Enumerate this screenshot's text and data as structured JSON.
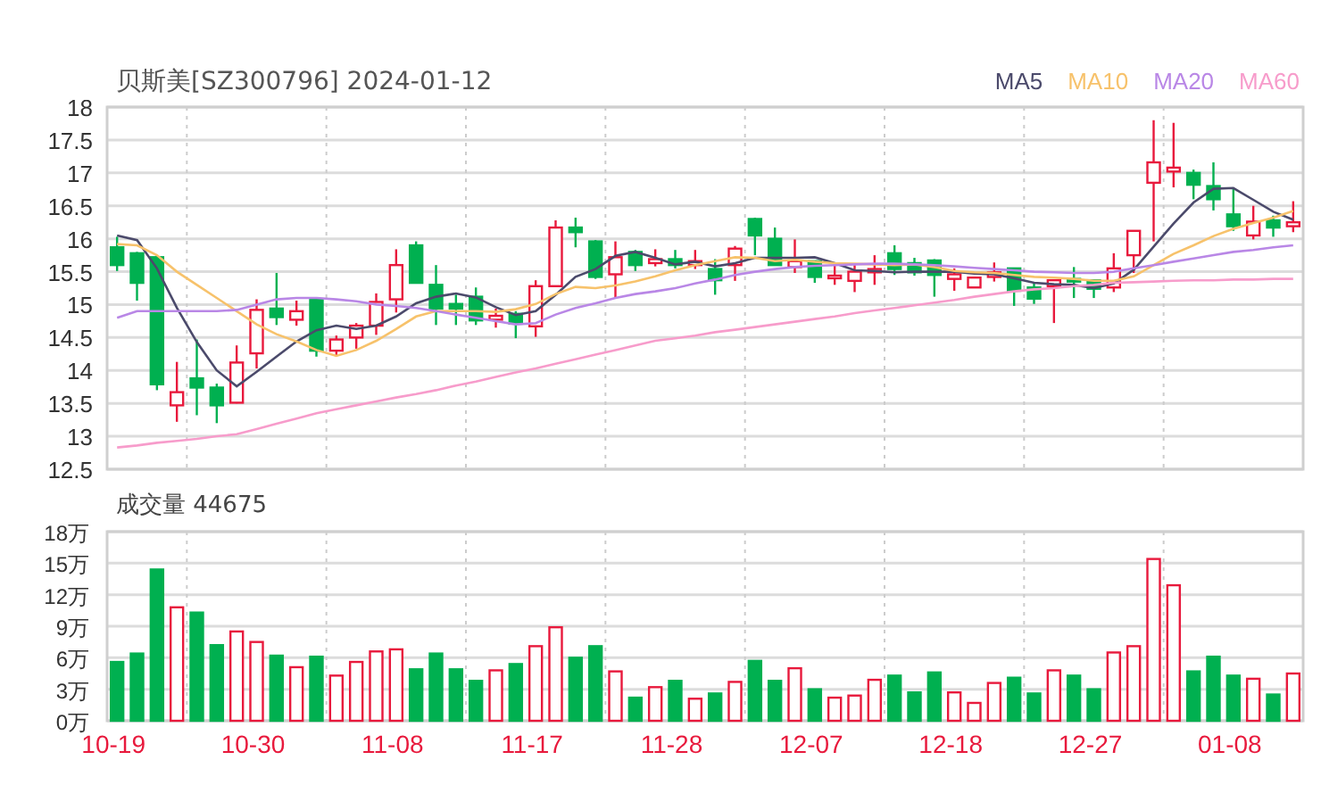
{
  "header": {
    "title": "贝斯美[SZ300796] 2024-01-12"
  },
  "price_chart": {
    "chart_data": {
      "type": "candlestick",
      "grid": true,
      "categories": [
        null,
        null,
        null,
        null,
        null,
        null,
        null,
        null,
        null,
        null,
        null,
        null,
        null,
        null,
        null,
        null,
        null,
        null,
        null,
        null,
        null,
        null,
        null,
        null,
        null,
        null,
        null,
        null,
        null,
        null,
        null,
        null,
        null,
        null,
        null,
        null,
        null,
        null,
        null,
        null,
        null,
        null,
        null,
        null,
        null,
        null,
        null,
        null,
        null,
        null,
        null,
        null,
        null,
        null,
        null,
        null,
        null,
        null,
        null,
        null
      ],
      "ylim": [
        12.5,
        18
      ],
      "yticks": [
        12.5,
        13,
        13.5,
        14,
        14.5,
        15,
        15.5,
        16,
        16.5,
        17,
        17.5,
        18
      ],
      "ohlc": [
        [
          15.87,
          16.03,
          15.51,
          15.6
        ],
        [
          15.78,
          15.8,
          15.06,
          15.33
        ],
        [
          15.72,
          15.75,
          13.7,
          13.79
        ],
        [
          13.47,
          14.13,
          13.22,
          13.67
        ],
        [
          13.88,
          14.47,
          13.32,
          13.74
        ],
        [
          13.74,
          13.8,
          13.2,
          13.47
        ],
        [
          13.51,
          14.38,
          13.5,
          14.12
        ],
        [
          14.26,
          15.08,
          14.03,
          14.92
        ],
        [
          14.94,
          15.48,
          14.69,
          14.81
        ],
        [
          14.77,
          15.06,
          14.68,
          14.9
        ],
        [
          15.08,
          15.1,
          14.21,
          14.3
        ],
        [
          14.3,
          14.53,
          14.21,
          14.47
        ],
        [
          14.5,
          14.72,
          14.33,
          14.68
        ],
        [
          14.68,
          15.17,
          14.54,
          15.04
        ],
        [
          15.08,
          15.84,
          14.88,
          15.6
        ],
        [
          15.9,
          15.96,
          15.33,
          15.33
        ],
        [
          15.3,
          15.6,
          14.69,
          14.94
        ],
        [
          15.01,
          15.15,
          14.69,
          14.94
        ],
        [
          15.12,
          15.26,
          14.69,
          14.76
        ],
        [
          14.77,
          14.94,
          14.65,
          14.83
        ],
        [
          14.86,
          14.9,
          14.49,
          14.71
        ],
        [
          14.67,
          15.37,
          14.51,
          15.28
        ],
        [
          15.28,
          16.28,
          15.28,
          16.17
        ],
        [
          16.17,
          16.32,
          15.87,
          16.1
        ],
        [
          15.96,
          15.98,
          15.39,
          15.42
        ],
        [
          15.46,
          15.96,
          15.1,
          15.72
        ],
        [
          15.8,
          15.83,
          15.51,
          15.6
        ],
        [
          15.63,
          15.84,
          15.58,
          15.69
        ],
        [
          15.69,
          15.83,
          15.55,
          15.6
        ],
        [
          15.6,
          15.83,
          15.54,
          15.66
        ],
        [
          15.54,
          15.69,
          15.15,
          15.37
        ],
        [
          15.6,
          15.89,
          15.36,
          15.85
        ],
        [
          16.3,
          16.32,
          15.75,
          16.05
        ],
        [
          16.0,
          16.17,
          15.6,
          15.6
        ],
        [
          15.57,
          15.99,
          15.48,
          15.66
        ],
        [
          15.66,
          15.66,
          15.33,
          15.42
        ],
        [
          15.4,
          15.6,
          15.3,
          15.44
        ],
        [
          15.36,
          15.6,
          15.19,
          15.5
        ],
        [
          15.49,
          15.75,
          15.3,
          15.54
        ],
        [
          15.78,
          15.9,
          15.45,
          15.54
        ],
        [
          15.63,
          15.71,
          15.44,
          15.49
        ],
        [
          15.67,
          15.69,
          15.12,
          15.45
        ],
        [
          15.39,
          15.55,
          15.21,
          15.46
        ],
        [
          15.26,
          15.41,
          15.26,
          15.41
        ],
        [
          15.42,
          15.64,
          15.35,
          15.49
        ],
        [
          15.55,
          15.55,
          14.98,
          15.21
        ],
        [
          15.26,
          15.33,
          15.01,
          15.09
        ],
        [
          15.28,
          15.37,
          14.72,
          15.37
        ],
        [
          15.39,
          15.57,
          15.1,
          15.35
        ],
        [
          15.37,
          15.37,
          15.1,
          15.24
        ],
        [
          15.26,
          15.78,
          15.19,
          15.55
        ],
        [
          15.75,
          16.12,
          15.48,
          16.12
        ],
        [
          16.85,
          17.8,
          15.96,
          17.16
        ],
        [
          17.02,
          17.76,
          16.78,
          17.08
        ],
        [
          17.0,
          17.05,
          16.6,
          16.82
        ],
        [
          16.8,
          17.16,
          16.43,
          16.6
        ],
        [
          16.37,
          16.78,
          16.12,
          16.19
        ],
        [
          16.05,
          16.5,
          15.99,
          16.26
        ],
        [
          16.28,
          16.35,
          16.03,
          16.17
        ],
        [
          16.19,
          16.57,
          16.1,
          16.25
        ]
      ]
    }
  },
  "moving_averages": {
    "chart_data": {
      "type": "line",
      "categories": [
        null,
        null,
        null,
        null,
        null,
        null,
        null,
        null,
        null,
        null,
        null,
        null,
        null,
        null,
        null,
        null,
        null,
        null,
        null,
        null,
        null,
        null,
        null,
        null,
        null,
        null,
        null,
        null,
        null,
        null,
        null,
        null,
        null,
        null,
        null,
        null,
        null,
        null,
        null,
        null,
        null,
        null,
        null,
        null,
        null,
        null,
        null,
        null,
        null,
        null,
        null,
        null,
        null,
        null,
        null,
        null,
        null,
        null,
        null,
        null
      ],
      "ylim": [
        12.5,
        18
      ],
      "series": [
        {
          "name": "MA5",
          "color": "#4b4a6b",
          "values": [
            16.05,
            15.98,
            15.55,
            14.95,
            14.43,
            14.0,
            13.76,
            13.98,
            14.21,
            14.44,
            14.61,
            14.68,
            14.63,
            14.68,
            14.82,
            15.02,
            15.12,
            15.17,
            15.11,
            14.96,
            14.84,
            14.9,
            15.15,
            15.42,
            15.54,
            15.74,
            15.8,
            15.71,
            15.61,
            15.65,
            15.58,
            15.63,
            15.71,
            15.71,
            15.71,
            15.72,
            15.63,
            15.52,
            15.51,
            15.49,
            15.5,
            15.5,
            15.5,
            15.47,
            15.46,
            15.4,
            15.33,
            15.31,
            15.3,
            15.25,
            15.32,
            15.53,
            15.88,
            16.23,
            16.55,
            16.76,
            16.77,
            16.59,
            16.41,
            16.29
          ]
        },
        {
          "name": "MA10",
          "color": "#f7c26b",
          "values": [
            15.92,
            15.9,
            15.75,
            15.5,
            15.3,
            15.1,
            14.9,
            14.7,
            14.55,
            14.44,
            14.31,
            14.22,
            14.31,
            14.45,
            14.63,
            14.82,
            14.9,
            14.9,
            14.9,
            14.89,
            14.93,
            15.01,
            15.16,
            15.27,
            15.25,
            15.29,
            15.35,
            15.43,
            15.52,
            15.6,
            15.66,
            15.72,
            15.71,
            15.66,
            15.68,
            15.65,
            15.63,
            15.62,
            15.61,
            15.6,
            15.61,
            15.57,
            15.51,
            15.49,
            15.48,
            15.45,
            15.42,
            15.41,
            15.39,
            15.36,
            15.36,
            15.43,
            15.6,
            15.77,
            15.9,
            16.04,
            16.15,
            16.24,
            16.32,
            16.42
          ]
        },
        {
          "name": "MA20",
          "color": "#b987e6",
          "values": [
            14.8,
            14.9,
            14.9,
            14.9,
            14.9,
            14.9,
            14.92,
            15.0,
            15.08,
            15.1,
            15.1,
            15.08,
            15.05,
            15.0,
            14.98,
            14.95,
            14.9,
            14.85,
            14.8,
            14.75,
            14.7,
            14.72,
            14.85,
            14.95,
            15.02,
            15.1,
            15.16,
            15.2,
            15.25,
            15.32,
            15.38,
            15.45,
            15.5,
            15.54,
            15.57,
            15.59,
            15.6,
            15.61,
            15.62,
            15.62,
            15.61,
            15.6,
            15.58,
            15.56,
            15.54,
            15.52,
            15.5,
            15.49,
            15.48,
            15.48,
            15.5,
            15.55,
            15.6,
            15.65,
            15.7,
            15.75,
            15.8,
            15.83,
            15.87,
            15.9
          ]
        },
        {
          "name": "MA60",
          "color": "#f79ccb",
          "values": [
            12.83,
            12.86,
            12.9,
            12.93,
            12.96,
            13.0,
            13.03,
            13.11,
            13.19,
            13.27,
            13.35,
            13.41,
            13.47,
            13.53,
            13.59,
            13.64,
            13.7,
            13.77,
            13.83,
            13.9,
            13.97,
            14.03,
            14.1,
            14.17,
            14.24,
            14.31,
            14.38,
            14.45,
            14.49,
            14.53,
            14.58,
            14.62,
            14.66,
            14.7,
            14.74,
            14.78,
            14.82,
            14.87,
            14.91,
            14.95,
            14.99,
            15.03,
            15.07,
            15.12,
            15.16,
            15.2,
            15.23,
            15.25,
            15.28,
            15.3,
            15.33,
            15.34,
            15.35,
            15.36,
            15.37,
            15.37,
            15.38,
            15.38,
            15.39,
            15.39
          ]
        }
      ]
    }
  },
  "volume_chart": {
    "chart_data": {
      "type": "bar",
      "grid": true,
      "title": "成交量 44675",
      "categories": [
        "10-19",
        null,
        null,
        null,
        null,
        null,
        null,
        "10-30",
        null,
        null,
        null,
        null,
        null,
        null,
        "11-08",
        null,
        null,
        null,
        null,
        null,
        null,
        "11-17",
        null,
        null,
        null,
        null,
        null,
        null,
        "11-28",
        null,
        null,
        null,
        null,
        null,
        null,
        "12-07",
        null,
        null,
        null,
        null,
        null,
        null,
        "12-18",
        null,
        null,
        null,
        null,
        null,
        null,
        "12-27",
        null,
        null,
        null,
        null,
        null,
        null,
        "01-08",
        null,
        null,
        null
      ],
      "ylim": [
        0,
        18
      ],
      "yticks": [
        {
          "value": 0,
          "label": "0万"
        },
        {
          "value": 3,
          "label": "3万"
        },
        {
          "value": 6,
          "label": "6万"
        },
        {
          "value": 9,
          "label": "9万"
        },
        {
          "value": 12,
          "label": "12万"
        },
        {
          "value": 15,
          "label": "15万"
        },
        {
          "value": 18,
          "label": "18万"
        }
      ],
      "values": [
        5.6,
        6.4,
        14.4,
        10.8,
        10.3,
        7.2,
        8.5,
        7.5,
        6.2,
        5.1,
        6.1,
        4.3,
        5.6,
        6.6,
        6.8,
        4.9,
        6.4,
        4.9,
        3.8,
        4.8,
        5.4,
        7.1,
        8.9,
        6.0,
        7.1,
        4.7,
        2.2,
        3.2,
        3.8,
        2.1,
        2.6,
        3.7,
        5.7,
        3.8,
        5.0,
        3.0,
        2.2,
        2.4,
        3.9,
        4.3,
        2.7,
        4.6,
        2.7,
        1.7,
        3.6,
        4.1,
        2.6,
        4.8,
        4.3,
        3.0,
        6.5,
        7.1,
        15.4,
        12.9,
        4.7,
        6.1,
        4.3,
        4.0,
        2.5,
        4.5
      ]
    }
  }
}
